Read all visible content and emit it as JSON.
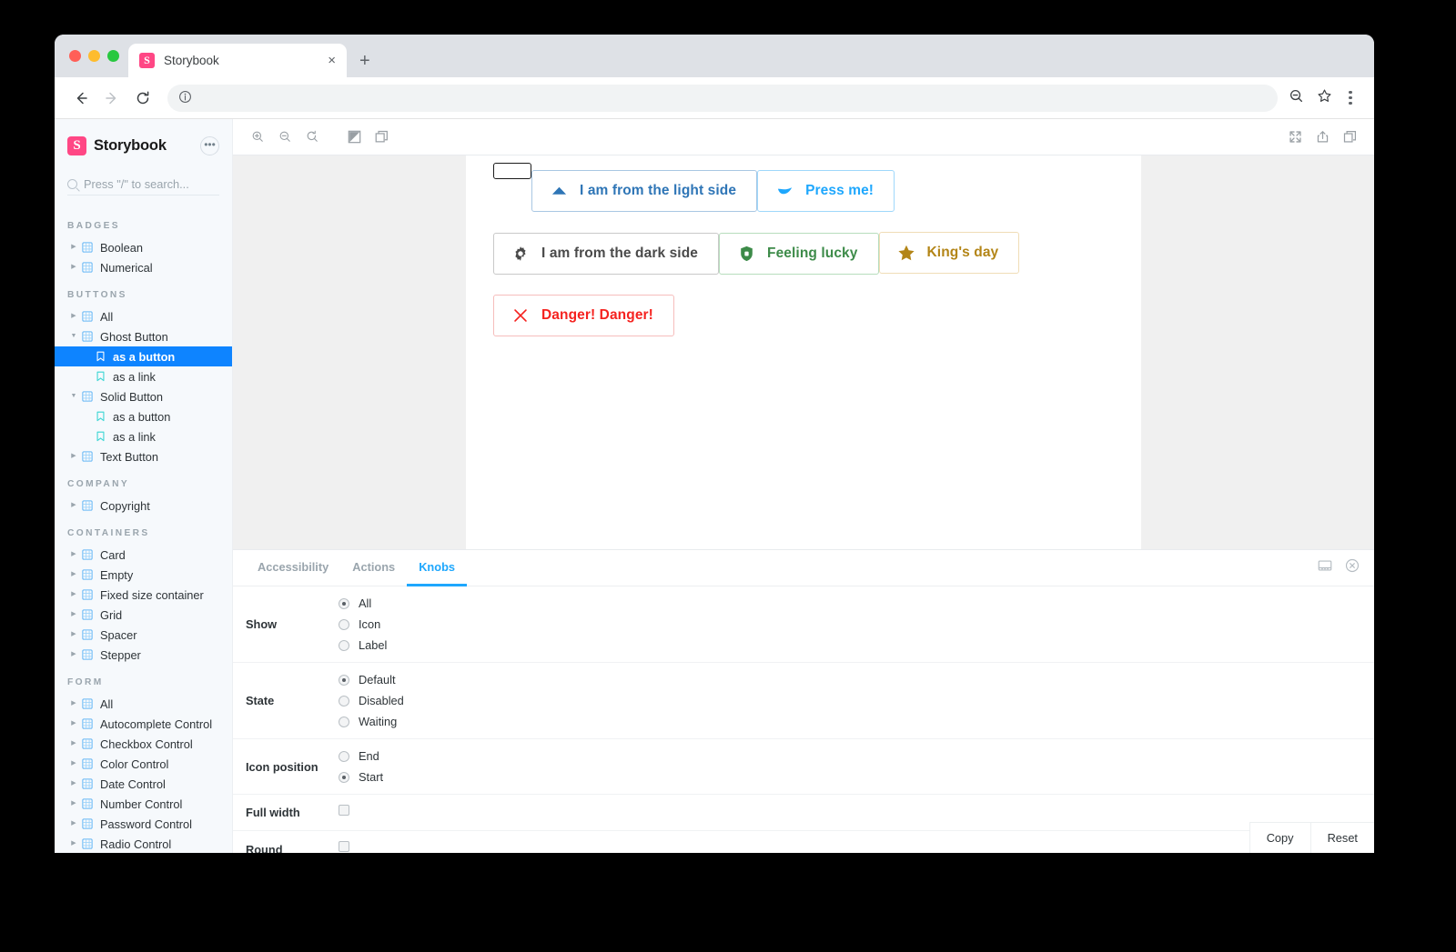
{
  "browser": {
    "tab_title": "Storybook",
    "favicon_letter": "S",
    "close_label": "×",
    "new_tab_label": "+",
    "back_icon": "back-arrow-icon",
    "forward_icon": "forward-arrow-icon",
    "reload_icon": "reload-icon",
    "info_icon": "info-icon",
    "omnibox_value": "",
    "omnibox_placeholder": "",
    "zoom_icon": "zoom-out-icon",
    "bookmark_icon": "star-icon",
    "menu_icon": "kebab-menu-icon"
  },
  "sidebar": {
    "brand": "Storybook",
    "logo_letter": "S",
    "more_label": "•••",
    "search_placeholder": "Press \"/\" to search...",
    "search_value": "",
    "groups": [
      {
        "label": "BADGES",
        "items": [
          {
            "label": "Boolean",
            "type": "component",
            "depth": 1,
            "expanded": false,
            "selected": false
          },
          {
            "label": "Numerical",
            "type": "component",
            "depth": 1,
            "expanded": false,
            "selected": false
          }
        ]
      },
      {
        "label": "BUTTONS",
        "items": [
          {
            "label": "All",
            "type": "component",
            "depth": 1,
            "expanded": false,
            "selected": false
          },
          {
            "label": "Ghost Button",
            "type": "component",
            "depth": 1,
            "expanded": true,
            "selected": false
          },
          {
            "label": "as a button",
            "type": "story",
            "depth": 2,
            "expanded": false,
            "selected": true
          },
          {
            "label": "as a link",
            "type": "story",
            "depth": 2,
            "expanded": false,
            "selected": false
          },
          {
            "label": "Solid Button",
            "type": "component",
            "depth": 1,
            "expanded": true,
            "selected": false
          },
          {
            "label": "as a button",
            "type": "story",
            "depth": 2,
            "expanded": false,
            "selected": false
          },
          {
            "label": "as a link",
            "type": "story",
            "depth": 2,
            "expanded": false,
            "selected": false
          },
          {
            "label": "Text Button",
            "type": "component",
            "depth": 1,
            "expanded": false,
            "selected": false
          }
        ]
      },
      {
        "label": "COMPANY",
        "items": [
          {
            "label": "Copyright",
            "type": "component",
            "depth": 1,
            "expanded": false,
            "selected": false
          }
        ]
      },
      {
        "label": "CONTAINERS",
        "items": [
          {
            "label": "Card",
            "type": "component",
            "depth": 1,
            "expanded": false,
            "selected": false
          },
          {
            "label": "Empty",
            "type": "component",
            "depth": 1,
            "expanded": false,
            "selected": false
          },
          {
            "label": "Fixed size container",
            "type": "component",
            "depth": 1,
            "expanded": false,
            "selected": false
          },
          {
            "label": "Grid",
            "type": "component",
            "depth": 1,
            "expanded": false,
            "selected": false
          },
          {
            "label": "Spacer",
            "type": "component",
            "depth": 1,
            "expanded": false,
            "selected": false
          },
          {
            "label": "Stepper",
            "type": "component",
            "depth": 1,
            "expanded": false,
            "selected": false
          }
        ]
      },
      {
        "label": "FORM",
        "items": [
          {
            "label": "All",
            "type": "component",
            "depth": 1,
            "expanded": false,
            "selected": false
          },
          {
            "label": "Autocomplete Control",
            "type": "component",
            "depth": 1,
            "expanded": false,
            "selected": false
          },
          {
            "label": "Checkbox Control",
            "type": "component",
            "depth": 1,
            "expanded": false,
            "selected": false
          },
          {
            "label": "Color Control",
            "type": "component",
            "depth": 1,
            "expanded": false,
            "selected": false
          },
          {
            "label": "Date Control",
            "type": "component",
            "depth": 1,
            "expanded": false,
            "selected": false
          },
          {
            "label": "Number Control",
            "type": "component",
            "depth": 1,
            "expanded": false,
            "selected": false
          },
          {
            "label": "Password Control",
            "type": "component",
            "depth": 1,
            "expanded": false,
            "selected": false
          },
          {
            "label": "Radio Control",
            "type": "component",
            "depth": 1,
            "expanded": false,
            "selected": false
          }
        ]
      }
    ]
  },
  "canvas_toolbar": {
    "left_icons": [
      "zoom-in-icon",
      "zoom-out-icon",
      "zoom-reset-icon",
      "background-contrast-icon",
      "grid-layers-icon"
    ],
    "right_icons": [
      "fullscreen-icon",
      "share-icon",
      "copy-icon"
    ]
  },
  "story": {
    "buttons": [
      {
        "label": "",
        "icon": "",
        "text_color": "#1b1b1b",
        "border_color": "#1b1b1b",
        "clipped": true
      },
      {
        "label": "I am from the light side",
        "icon": "triangle-up",
        "text_color": "#2e75b6",
        "border_color": "#a9c7e3",
        "clipped": false
      },
      {
        "label": "Press me!",
        "icon": "swoosh",
        "text_color": "#1ea7fd",
        "border_color": "#9fd8fb",
        "clipped": false
      },
      {
        "label": "I am from the dark side",
        "icon": "gear",
        "text_color": "#4a4a4a",
        "border_color": "#c9c9c9",
        "clipped": false
      },
      {
        "label": "Feeling lucky",
        "icon": "shield-lock",
        "text_color": "#3d8b49",
        "border_color": "#b7ddbd",
        "clipped": false
      },
      {
        "label": "King's day",
        "icon": "star",
        "text_color": "#b38517",
        "border_color": "#f0ddb6",
        "clipped": false
      },
      {
        "label": "Danger! Danger!",
        "icon": "x-mark",
        "text_color": "#f5221f",
        "border_color": "#f6bdbc",
        "clipped": false
      }
    ]
  },
  "addon_panel": {
    "tabs": [
      {
        "label": "Accessibility",
        "active": false
      },
      {
        "label": "Actions",
        "active": false
      },
      {
        "label": "Knobs",
        "active": true
      }
    ],
    "right_icons": [
      "panel-position-icon",
      "close-panel-icon"
    ],
    "active_tab_color": "#1ea7fd",
    "knobs": [
      {
        "label": "Show",
        "control": "radio",
        "options": [
          {
            "label": "All",
            "selected": true
          },
          {
            "label": "Icon",
            "selected": false
          },
          {
            "label": "Label",
            "selected": false
          }
        ]
      },
      {
        "label": "State",
        "control": "radio",
        "options": [
          {
            "label": "Default",
            "selected": true
          },
          {
            "label": "Disabled",
            "selected": false
          },
          {
            "label": "Waiting",
            "selected": false
          }
        ]
      },
      {
        "label": "Icon position",
        "control": "radio",
        "options": [
          {
            "label": "End",
            "selected": false
          },
          {
            "label": "Start",
            "selected": true
          }
        ]
      },
      {
        "label": "Full width",
        "control": "checkbox",
        "checked": false
      },
      {
        "label": "Round",
        "control": "checkbox",
        "checked": false
      }
    ],
    "footer": {
      "copy_label": "Copy",
      "reset_label": "Reset"
    }
  }
}
